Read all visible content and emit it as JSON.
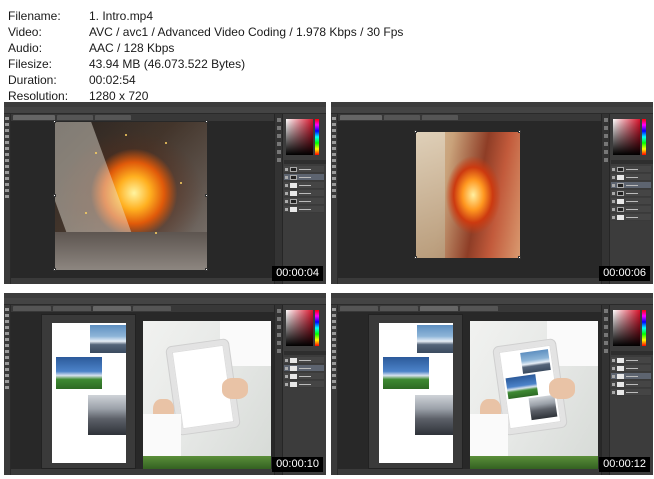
{
  "metadata": [
    {
      "key": "Filename:",
      "value": "1. Intro.mp4"
    },
    {
      "key": "Video:",
      "value": "AVC / avc1 / Advanced Video Coding / 1.978 Kbps / 30 Fps"
    },
    {
      "key": "Audio:",
      "value": "AAC / 128 Kbps"
    },
    {
      "key": "Filesize:",
      "value": "43.94 MB (46.073.522 Bytes)"
    },
    {
      "key": "Duration:",
      "value": "00:02:54"
    },
    {
      "key": "Resolution:",
      "value": "1280 x 720"
    }
  ],
  "thumbnails": [
    {
      "timestamp": "00:00:04",
      "scene": "fire-explosion"
    },
    {
      "timestamp": "00:00:06",
      "scene": "fire-wood"
    },
    {
      "timestamp": "00:00:10",
      "scene": "collage-tablet-blank"
    },
    {
      "timestamp": "00:00:12",
      "scene": "collage-tablet-filled"
    }
  ],
  "colors": {
    "app_bg": "#535353",
    "canvas_bg": "#282828",
    "panel_bg": "#3c3c3c",
    "timestamp_bg": "#000000",
    "timestamp_fg": "#ffffff"
  }
}
